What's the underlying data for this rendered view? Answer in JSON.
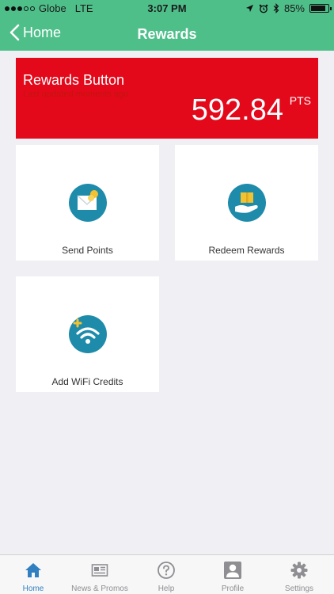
{
  "status_bar": {
    "carrier": "Globe",
    "network": "LTE",
    "time": "3:07 PM",
    "battery_text": "85%",
    "battery_level": 0.85
  },
  "nav": {
    "back_label": "Home",
    "title": "Rewards"
  },
  "rewards": {
    "title": "Rewards Button",
    "subtitle": "Last updated moments ago",
    "points": "592.84",
    "unit": "PTS",
    "color": "#e3091b"
  },
  "tiles": [
    {
      "label": "Send Points",
      "icon": "send-points-icon"
    },
    {
      "label": "Redeem Rewards",
      "icon": "redeem-rewards-icon"
    },
    {
      "label": "Add WiFi Credits",
      "icon": "wifi-credits-icon"
    }
  ],
  "tab_bar": {
    "items": [
      {
        "label": "Home",
        "icon": "home-icon",
        "active": true
      },
      {
        "label": "News & Promos",
        "icon": "news-icon",
        "active": false
      },
      {
        "label": "Help",
        "icon": "help-icon",
        "active": false
      },
      {
        "label": "Profile",
        "icon": "profile-icon",
        "active": false
      },
      {
        "label": "Settings",
        "icon": "gear-icon",
        "active": false
      }
    ]
  },
  "colors": {
    "header": "#4fbf8a",
    "background": "#efeff4",
    "icon_circle": "#1f8bab",
    "tab_active": "#2f7fc1",
    "tab_inactive": "#8e8e93"
  }
}
